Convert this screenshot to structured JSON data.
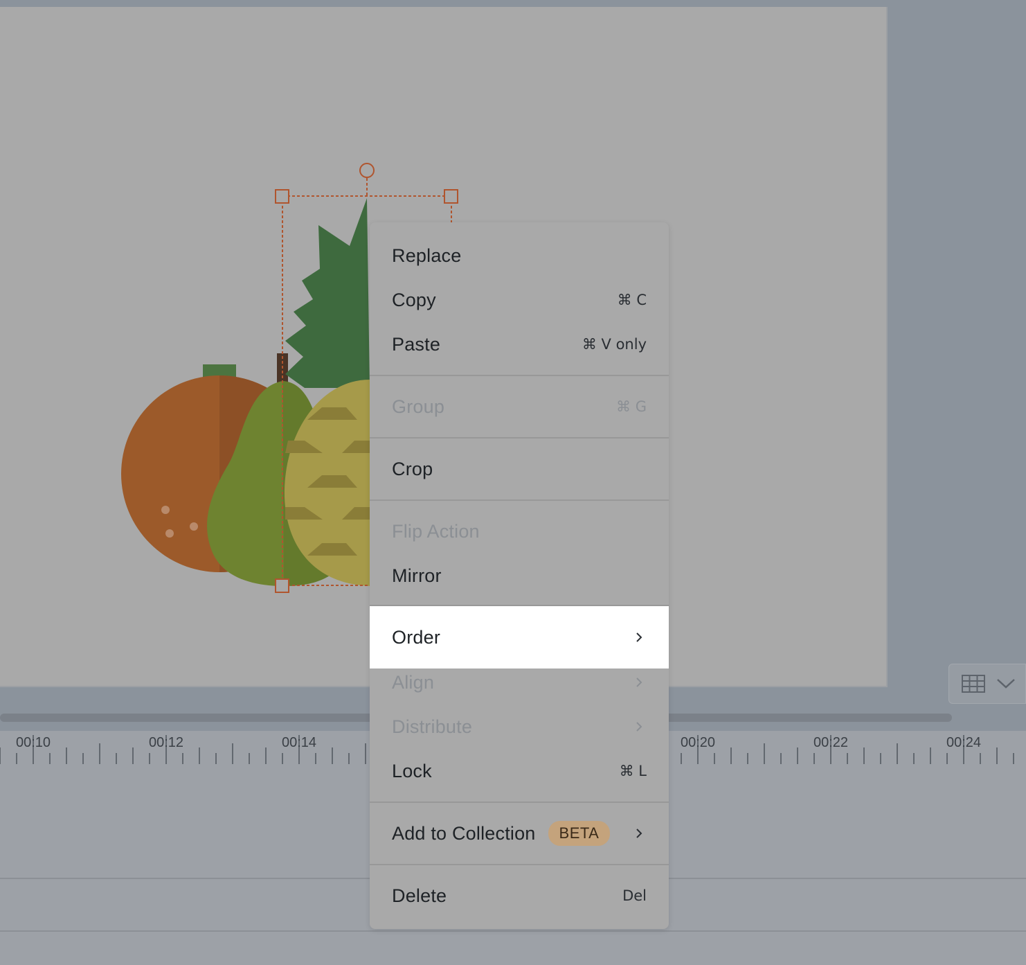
{
  "timeline": {
    "labels": [
      "00:10",
      "00:12",
      "00:14",
      "00:20",
      "00:22",
      "00:24"
    ]
  },
  "view_toggle": {
    "icon": "grid-icon",
    "dropdown_icon": "chevron-down-icon"
  },
  "context_menu": {
    "replace": "Replace",
    "copy": "Copy",
    "copy_shortcut": "⌘ C",
    "paste": "Paste",
    "paste_shortcut": "⌘ V only",
    "group": "Group",
    "group_shortcut": "⌘ G",
    "crop": "Crop",
    "flip_action": "Flip Action",
    "mirror": "Mirror",
    "order": "Order",
    "align": "Align",
    "distribute": "Distribute",
    "lock": "Lock",
    "lock_shortcut": "⌘ L",
    "add_to_collection": "Add to Collection",
    "beta_badge": "BETA",
    "delete": "Delete",
    "delete_shortcut": "Del"
  },
  "colors": {
    "orange": "#9c5a2a",
    "pear": "#6e8330",
    "pineapple": "#a69a4a",
    "leaf": "#3e6a3e",
    "selection": "#b0552e",
    "beta_badge": "#c4a37c"
  }
}
